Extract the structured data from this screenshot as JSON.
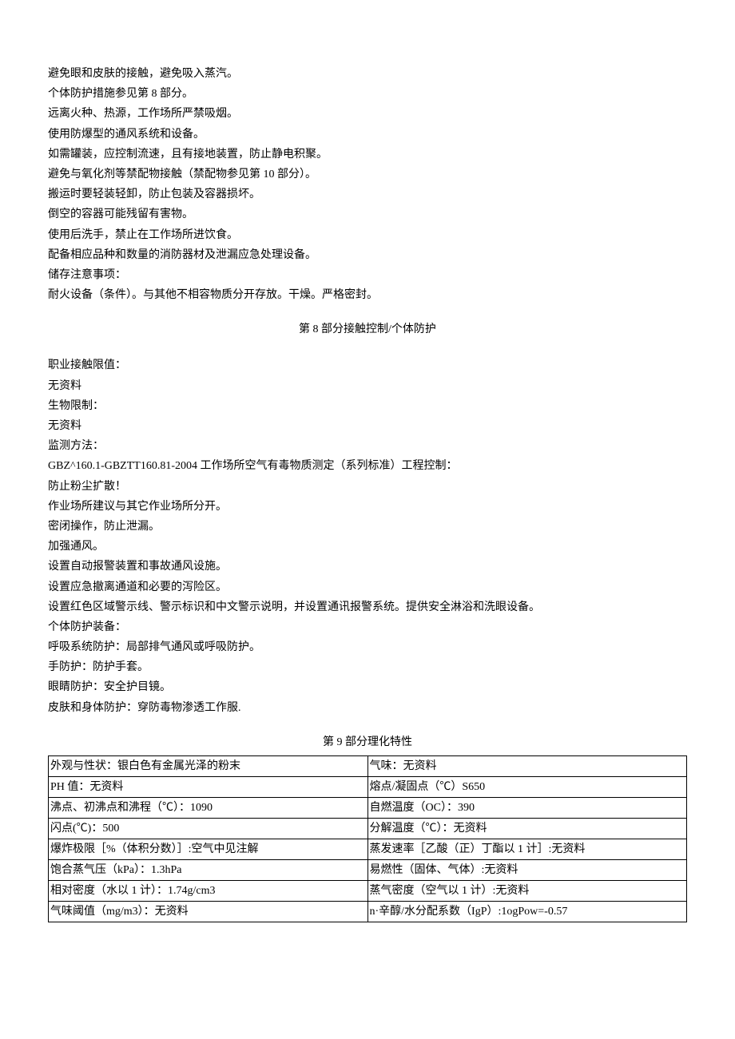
{
  "section7": {
    "lines": [
      "避免眼和皮肤的接触，避免吸入蒸汽。",
      "个体防护措施参见第 8 部分。",
      "远离火种、热源，工作场所严禁吸烟。",
      "使用防爆型的通风系统和设备。",
      "如需罐装，应控制流速，且有接地装置，防止静电积聚。",
      "避免与氧化剂等禁配物接触（禁配物参见第 10 部分）。",
      "搬运时要轻装轻卸，防止包装及容器损坏。",
      "倒空的容器可能残留有害物。",
      "使用后洗手，禁止在工作场所进饮食。",
      "配备相应品种和数量的消防器材及泄漏应急处理设备。",
      "储存注意事项：",
      "耐火设备（条件）。与其他不相容物质分开存放。干燥。严格密封。"
    ]
  },
  "section8": {
    "heading": "第 8 部分接触控制/个体防护",
    "lines": [
      "职业接触限值：",
      "无资料",
      "生物限制：",
      "无资料",
      "监测方法：",
      "GBZ^160.1-GBZTT160.81-2004 工作场所空气有毒物质测定（系列标准）工程控制：",
      "防止粉尘扩散！",
      "作业场所建议与其它作业场所分开。",
      "密闭操作，防止泄漏。",
      "加强通风。",
      "设置自动报警装置和事故通风设施。",
      "设置应急撤离通道和必要的泻险区。",
      "设置红色区域警示线、警示标识和中文警示说明，并设置通讯报警系统。提供安全淋浴和洗眼设备。",
      "个体防护装备：",
      "呼吸系统防护：局部排气通风或呼吸防护。",
      "手防护：防护手套。",
      "眼睛防护：安全护目镜。",
      "皮肤和身体防护：穿防毒物渗透工作服."
    ]
  },
  "section9": {
    "heading": "第 9 部分理化特性",
    "rows": [
      [
        "外观与性状：银白色有金属光泽的粉末",
        "气味：无资料"
      ],
      [
        "PH 值：无资料",
        "熔点/凝固点（℃）S650"
      ],
      [
        "沸点、初沸点和沸程（℃）：1090",
        "自燃温度（OC）：390"
      ],
      [
        "闪点(℃)：500",
        "分解温度（℃）：无资料"
      ],
      [
        "爆炸极限［%（体积分数）］:空气中见注解",
        "蒸发速率［乙酸（正）丁酯以 1 计］:无资料"
      ],
      [
        "饱合蒸气压（kPa）：1.3hPa",
        "易燃性（固体、气体）:无资料"
      ],
      [
        "相对密度（水以 1 计）：1.74g/cm3",
        "蒸气密度（空气以 1 计）:无资料"
      ],
      [
        "气味阈值（mg/m3）：无资料",
        "n·辛醇/水分配系数（IgP）:1ogPow=-0.57"
      ]
    ]
  }
}
